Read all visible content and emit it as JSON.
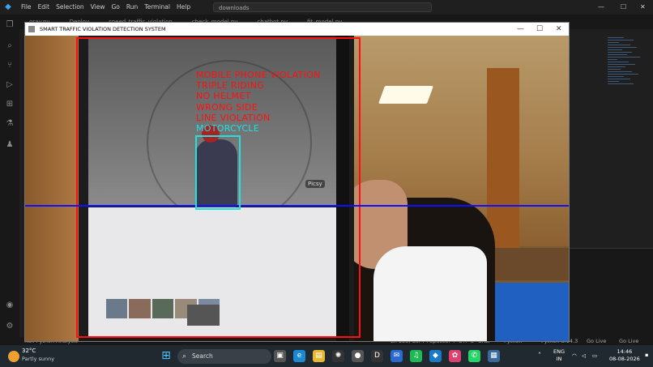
{
  "vscode": {
    "menu": [
      "File",
      "Edit",
      "Selection",
      "View",
      "Go",
      "Run",
      "Terminal",
      "Help"
    ],
    "command_center": "downloads",
    "tabs": [
      "gray.py",
      "Deploy",
      "speed_traffic_violation",
      "check_model.py",
      "chatbot.py",
      "fit_model.py"
    ],
    "status_left": "Run Python Analysis",
    "status_right": [
      "Ln 158, Col 74",
      "Spaces: 4",
      "UTF-8",
      "CRLF",
      "Python",
      "Python 3.14.3",
      "Go Live"
    ]
  },
  "app_window": {
    "title": "SMART TRAFFIC VIOLATION DETECTION SYSTEM",
    "minimize": "—",
    "maximize": "☐",
    "close": "✕"
  },
  "feed": {
    "violations": [
      "MOBILE PHONE VIOLATION",
      "TRIPLE RIDING",
      "NO HELMET",
      "WRONG SIDE",
      "LINE VIOLATION"
    ],
    "vehicle_label": "MOTORCYCLE",
    "phone_badge": "Picsy",
    "colors": {
      "violation_box": "#ff1010",
      "line": "#1010ff",
      "vehicle_box": "#22e0e0"
    }
  },
  "taskbar": {
    "temperature": "32°C",
    "condition": "Partly sunny",
    "search_placeholder": "Search",
    "language": "ENG",
    "region": "IN",
    "time": "14:46",
    "date": "08-08-2026"
  }
}
